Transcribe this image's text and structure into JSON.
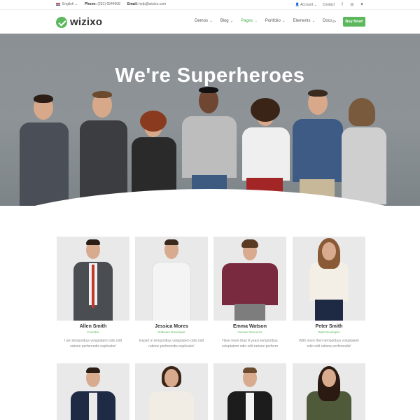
{
  "topbar": {
    "language": "English",
    "phone_label": "Phone:",
    "phone": "(231) 6544008",
    "email_label": "Email:",
    "email": "help@wizixo.com",
    "account": "Account",
    "contact": "Contact",
    "social": [
      "facebook-icon",
      "instagram-icon",
      "twitter-icon"
    ]
  },
  "header": {
    "logo_text": "wizixo",
    "nav": [
      {
        "label": "Demos",
        "active": false
      },
      {
        "label": "Blog",
        "active": false
      },
      {
        "label": "Pages",
        "active": true
      },
      {
        "label": "Portfolio",
        "active": false
      },
      {
        "label": "Elements",
        "active": false
      },
      {
        "label": "Docs",
        "active": false
      }
    ],
    "buy_label": "Buy Now!",
    "accent": "#5cb85c"
  },
  "hero": {
    "title": "We're Superheroes"
  },
  "team": [
    {
      "name": "Allen Smith",
      "role": "Founder",
      "desc": "I am temporibus voluptatem odio odit ratione perferendis explicabo!"
    },
    {
      "name": "Jessica Mores",
      "role": "Software Developer",
      "desc": "Expert in temporibus voluptatem odio odit ratione perferendis explicabo!"
    },
    {
      "name": "Emma Watson",
      "role": "Human Resource",
      "desc": "Have more than 8 years temporibus voluptatem odio odit ratione perferer"
    },
    {
      "name": "Peter Smith",
      "role": "Web Developer",
      "desc": "With more then temporibus voluptatem odio odit ratione perferendis!"
    }
  ]
}
